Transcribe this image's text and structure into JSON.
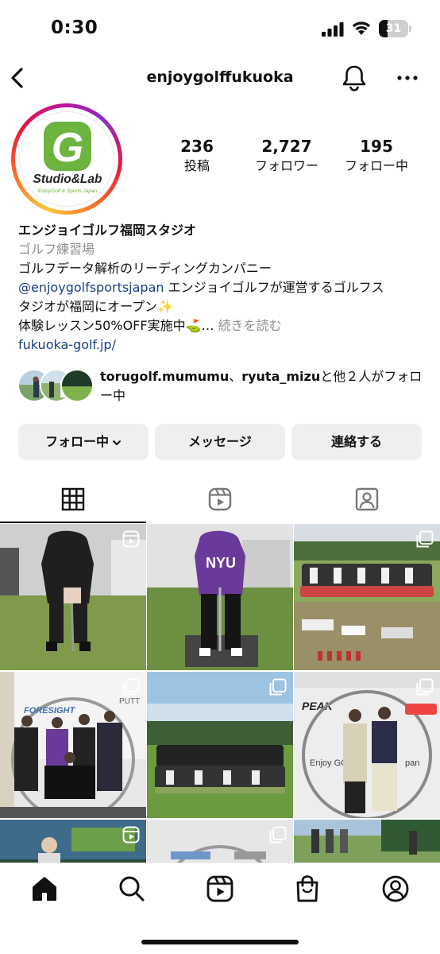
{
  "status": {
    "time": "0:30",
    "battery": "31",
    "battery_level": 0.31
  },
  "header": {
    "username": "enjoygolffukuoka"
  },
  "profile": {
    "avatar_title": "Studio&Lab",
    "avatar_subtitle": "EnjoyGolf & Sports Japan",
    "avatar_letter": "G",
    "stats": [
      {
        "value": "236",
        "label": "投稿"
      },
      {
        "value": "2,727",
        "label": "フォロワー"
      },
      {
        "value": "195",
        "label": "フォロー中"
      }
    ],
    "name": "エンジョイゴルフ福岡スタジオ",
    "category": "ゴルフ練習場",
    "bio_line1": "ゴルフデータ解析のリーディングカンパニー",
    "mention": "@enjoygolfsportsjapan",
    "bio_line2_rest": " エンジョイゴルフが運営するゴルフス",
    "bio_line3": "タジオが福岡にオープン✨",
    "bio_line4": "体験レッスン50%OFF実施中⛳…",
    "more_label": " 続きを読む",
    "link": "fukuoka-golf.jp/"
  },
  "followed_by": {
    "user1": "torugolf.mumumu",
    "sep": "、",
    "user2": "ryuta_mizu",
    "suffix": "と他２人がフォロー中"
  },
  "actions": {
    "follow": "フォロー中",
    "message": "メッセージ",
    "contact": "連絡する"
  },
  "grid_text": {
    "nyu": "NYU",
    "enjoy": "Enjoy GO",
    "peak": "PEAK",
    "foresight": "FORESIGHT",
    "putt": "PUTT",
    "pan": "pan"
  },
  "colors": {
    "link": "#1a3f83",
    "button_bg": "#efefef",
    "muted": "#8e8e8e",
    "logo_green": "#6cb33f"
  }
}
